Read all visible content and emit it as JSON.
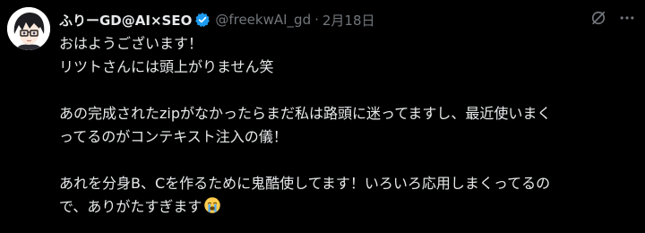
{
  "post": {
    "author": {
      "display_name": "ふりーGD@AI×SEO",
      "handle": "@freekwAI_gd",
      "verified": true,
      "avatar_icon": "anime-avatar-icon"
    },
    "separator": "·",
    "date": "2月18日",
    "actions": {
      "grok_icon": "grok-icon",
      "more_icon": "more-icon"
    },
    "lines": [
      "おはようございます！",
      "リツトさんには頭上がりません笑",
      "",
      "あの完成されたzipがなかったらまだ私は路頭に迷ってますし、最近使いまく",
      "ってるのがコンテキスト注入の儀！",
      "",
      "あれを分身B、Cを作るために鬼酷使してます！いろいろ応用しまくってるの",
      "で、ありがたすぎます"
    ],
    "trailing_emoji": "loudly-crying-face-emoji",
    "colors": {
      "background": "#000000",
      "text": "#e7e9ea",
      "secondary": "#71767b",
      "verified": "#1d9bf0"
    }
  }
}
